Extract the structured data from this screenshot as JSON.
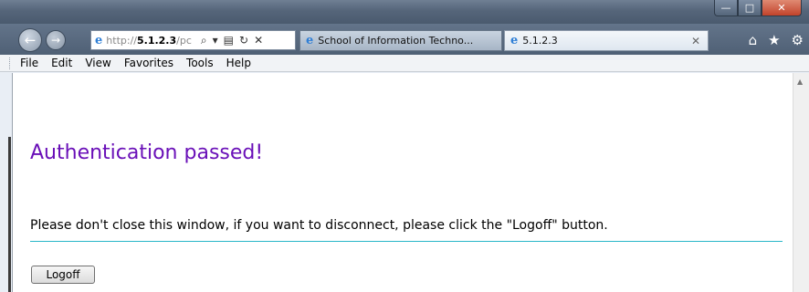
{
  "window": {
    "minimize_glyph": "—",
    "maximize_glyph": "□",
    "close_glyph": "✕"
  },
  "nav": {
    "back_glyph": "←",
    "forward_glyph": "→",
    "address_prefix": "http://",
    "address_host": "5.1.2.3",
    "address_rest": "/pc",
    "tools": [
      "⌕",
      "▾",
      "▤",
      "↻",
      "✕"
    ]
  },
  "tabs": [
    {
      "label": "School of Information Techno...",
      "icon": "ie-icon"
    },
    {
      "label": "5.1.2.3",
      "icon": "ie-icon",
      "close": "✕"
    }
  ],
  "right_nav": {
    "home": "⌂",
    "favorites": "★",
    "tools": "⚙"
  },
  "menu": [
    "File",
    "Edit",
    "View",
    "Favorites",
    "Tools",
    "Help"
  ],
  "page": {
    "title": "Authentication passed!",
    "notice": "Please don't close this window, if you want to disconnect, please click the \"Logoff\" button.",
    "logoff_label": "Logoff"
  },
  "colors": {
    "title": "#6a10b8",
    "divider": "#28b7c9"
  }
}
